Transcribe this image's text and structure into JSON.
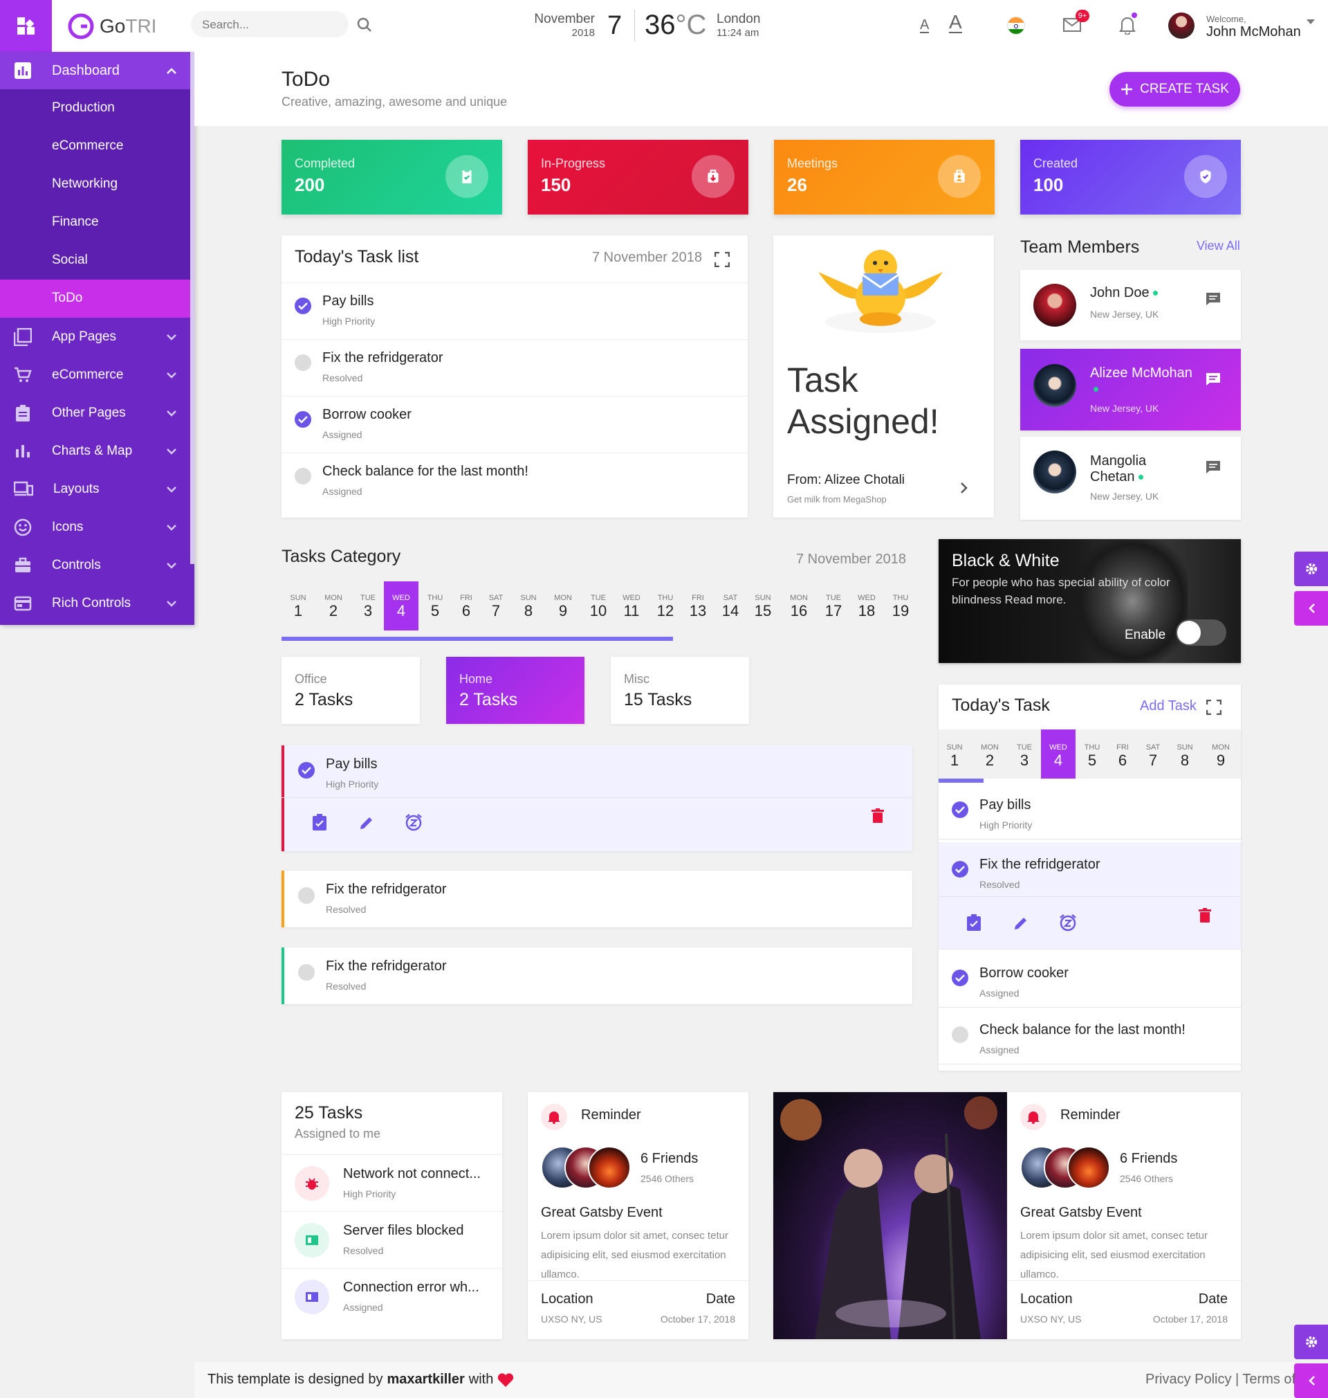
{
  "header": {
    "logo_bold": "Go",
    "logo_light": "TRI",
    "search_placeholder": "Search...",
    "month": "November",
    "year": "2018",
    "day": "7",
    "temp": "36",
    "deg": "°C",
    "city": "London",
    "time": "11:24 am",
    "badge": "9+",
    "welcome": "Welcome,",
    "user": "John McMohan"
  },
  "sidebar": {
    "dashboard": "Dashboard",
    "subitems": [
      "Production",
      "eCommerce",
      "Networking",
      "Finance",
      "Social",
      "ToDo"
    ],
    "menu": [
      "App Pages",
      "eCommerce",
      "Other Pages",
      "Charts & Map",
      "Layouts",
      "Icons",
      "Controls",
      "Rich Controls"
    ]
  },
  "page": {
    "title": "ToDo",
    "subtitle": "Creative, amazing, awesome and unique",
    "create": "CREATE TASK"
  },
  "stats": [
    {
      "label": "Completed",
      "value": "200",
      "color": "#1dc78a"
    },
    {
      "label": "In-Progress",
      "value": "150",
      "color": "#e8123c"
    },
    {
      "label": "Meetings",
      "value": "26",
      "color": "#fb9a12"
    },
    {
      "label": "Created",
      "value": "100",
      "color": "#6a3ff0"
    }
  ],
  "tasklist": {
    "title": "Today's Task list",
    "date": "7 November 2018",
    "items": [
      {
        "name": "Pay bills",
        "status": "High Priority",
        "done": true
      },
      {
        "name": "Fix the refridgerator",
        "status": "Resolved",
        "done": false
      },
      {
        "name": "Borrow cooker",
        "status": "Assigned",
        "done": true
      },
      {
        "name": "Check balance for the last month!",
        "status": "Assigned",
        "done": false
      }
    ]
  },
  "assigned": {
    "line1": "Task",
    "line2": "Assigned!",
    "from": "From: Alizee Chotali",
    "note": "Get milk from MegaShop"
  },
  "team": {
    "title": "Team Members",
    "view_all": "View All",
    "members": [
      {
        "name": "John Doe",
        "loc": "New Jersey, UK"
      },
      {
        "name": "Alizee McMohan",
        "loc": "New Jersey, UK"
      },
      {
        "name": "Mangolia Chetan",
        "loc": "New Jersey, UK"
      }
    ]
  },
  "category": {
    "title": "Tasks Category",
    "date": "7 November 2018",
    "days": [
      [
        "SUN",
        "1"
      ],
      [
        "MON",
        "2"
      ],
      [
        "TUE",
        "3"
      ],
      [
        "WED",
        "4"
      ],
      [
        "THU",
        "5"
      ],
      [
        "FRI",
        "6"
      ],
      [
        "SAT",
        "7"
      ],
      [
        "SUN",
        "8"
      ],
      [
        "MON",
        "9"
      ],
      [
        "TUE",
        "10"
      ],
      [
        "WED",
        "11"
      ],
      [
        "THU",
        "12"
      ],
      [
        "FRI",
        "13"
      ],
      [
        "SAT",
        "14"
      ],
      [
        "SUN",
        "15"
      ],
      [
        "MON",
        "16"
      ],
      [
        "TUE",
        "17"
      ],
      [
        "WED",
        "18"
      ],
      [
        "THU",
        "19"
      ]
    ],
    "tabs": [
      {
        "label": "Office",
        "count": "2 Tasks"
      },
      {
        "label": "Home",
        "count": "2 Tasks"
      },
      {
        "label": "Misc",
        "count": "15 Tasks"
      }
    ],
    "tasks": [
      {
        "name": "Pay bills",
        "status": "High Priority"
      },
      {
        "name": "Fix the refridgerator",
        "status": "Resolved"
      },
      {
        "name": "Fix the refridgerator",
        "status": "Resolved"
      }
    ]
  },
  "bw": {
    "title": "Black & White",
    "text": "For people who has special ability of color blindness Read more.",
    "enable": "Enable"
  },
  "today": {
    "title": "Today's Task",
    "add": "Add Task",
    "days": [
      [
        "SUN",
        "1"
      ],
      [
        "MON",
        "2"
      ],
      [
        "TUE",
        "3"
      ],
      [
        "WED",
        "4"
      ],
      [
        "THU",
        "5"
      ],
      [
        "FRI",
        "6"
      ],
      [
        "SAT",
        "7"
      ],
      [
        "SUN",
        "8"
      ],
      [
        "MON",
        "9"
      ]
    ],
    "items": [
      {
        "name": "Pay bills",
        "status": "High Priority"
      },
      {
        "name": "Fix the refridgerator",
        "status": "Resolved"
      },
      {
        "name": "Borrow cooker",
        "status": "Assigned"
      },
      {
        "name": "Check balance for the last month!",
        "status": "Assigned"
      }
    ]
  },
  "mytasks": {
    "title": "25 Tasks",
    "subtitle": "Assigned to me",
    "items": [
      {
        "name": "Network not connect...",
        "status": "High Priority"
      },
      {
        "name": "Server files blocked",
        "status": "Resolved"
      },
      {
        "name": "Connection error wh...",
        "status": "Assigned"
      }
    ]
  },
  "reminder": {
    "title": "Reminder",
    "friends": "6 Friends",
    "others": "2546 Others",
    "event": "Great Gatsby Event",
    "desc": "Lorem ipsum dolor sit amet, consec tetur adipisicing elit, sed eiusmod exercitation ullamco.",
    "location_label": "Location",
    "location": "UXSO NY, US",
    "date_label": "Date",
    "date": "October 17, 2018"
  },
  "footer": {
    "text": "This template is designed by",
    "author": "maxartkiller",
    "with": "with",
    "links": "Privacy Policy | Terms of"
  }
}
